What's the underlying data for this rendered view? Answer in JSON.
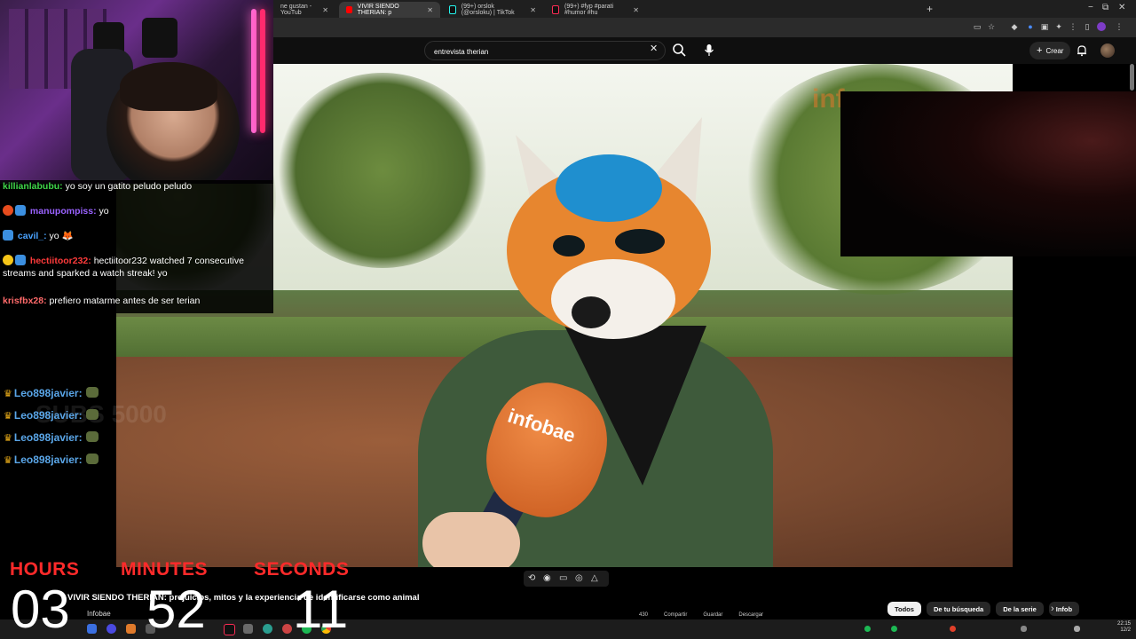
{
  "browser": {
    "tabs": [
      {
        "label": "ne gustan - YouTub",
        "active": false
      },
      {
        "label": "VIVIR SIENDO THERIAN: p",
        "active": true
      },
      {
        "label": "(99+) orslok (@orsloku) | TikTok",
        "active": false
      },
      {
        "label": "(99+) #fyp #parati #humor #hu",
        "active": false
      }
    ],
    "new_tab": "+",
    "window_controls": [
      "−",
      "⧉",
      "✕"
    ]
  },
  "youtube": {
    "search_value": "entrevista therian",
    "create_label": "Crear",
    "video_title": "VIVIR SIENDO THERIAN: prejuicios, mitos y la experiencia de identificarse como animal",
    "channel_name": "Infobae",
    "actions": [
      "430",
      "Compartir",
      "Guardar",
      "Descargar"
    ],
    "chips": [
      "Todos",
      "De tu búsqueda",
      "De la serie",
      "Infob"
    ],
    "mic_brand": "infobae"
  },
  "chat": {
    "messages": [
      {
        "user": "killianlabubu:",
        "text": "yo soy un gatito peludo peludo",
        "color": "#3fd64a"
      },
      {
        "user": "manupompiss:",
        "text": "yo",
        "color": "#9a62ff"
      },
      {
        "user": "cavil_:",
        "text": "yo 🦊",
        "color": "#4aa3ff"
      },
      {
        "user": "hectiitoor232:",
        "text": "hectiitoor232 watched 7 consecutive streams and sparked a watch streak! yo",
        "color": "#ff3b3b"
      },
      {
        "user": "krisfbx28:",
        "text": "prefiero matarme antes de ser terian",
        "color": "#ff6a6a"
      }
    ],
    "watermark": "SUBS 5000"
  },
  "leo_list": [
    "Leo898javier:",
    "Leo898javier:",
    "Leo898javier:",
    "Leo898javier:"
  ],
  "timer": {
    "labels": [
      "HOURS",
      "MINUTES",
      "SECONDS"
    ],
    "values": [
      "03",
      "52",
      "11"
    ],
    "label_color": "#ff2a2a"
  },
  "taskbar": {
    "clock_time": "22:15",
    "clock_date": "12/2"
  }
}
